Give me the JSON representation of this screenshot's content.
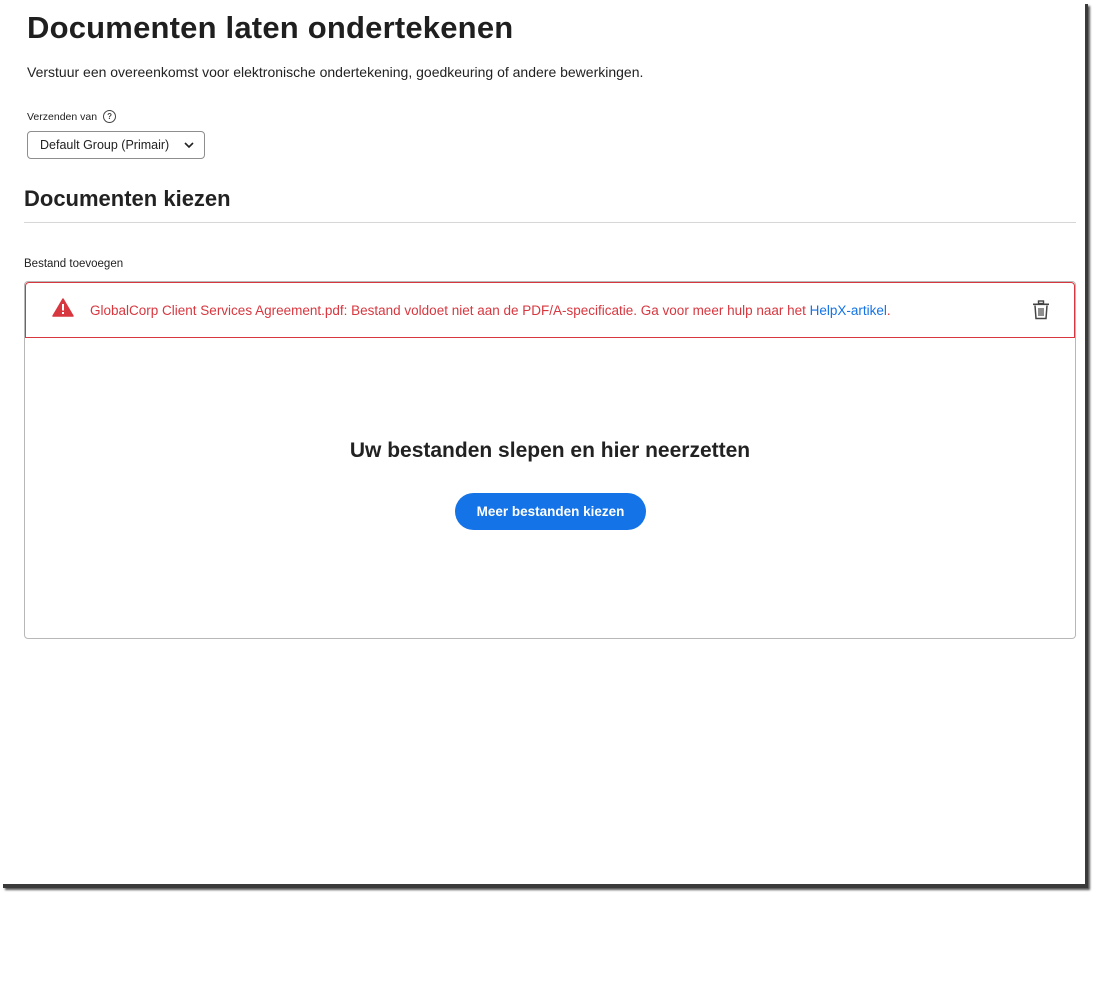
{
  "header": {
    "title": "Documenten laten ondertekenen",
    "subtitle": "Verstuur een overeenkomst voor elektronische ondertekening, goedkeuring of andere bewerkingen."
  },
  "send_from": {
    "label": "Verzenden van",
    "help_glyph": "?",
    "selected": "Default Group (Primair)"
  },
  "documents": {
    "section_title": "Documenten kiezen",
    "add_file_label": "Bestand toevoegen",
    "error": {
      "message": "GlobalCorp Client Services Agreement.pdf: Bestand voldoet niet aan de PDF/A-specificatie. Ga voor meer hulp naar het ",
      "link_text": "HelpX-artikel",
      "suffix": ".",
      "color": "#d7373f"
    },
    "drop_title": "Uw bestanden slepen en hier neerzetten",
    "choose_button": "Meer bestanden kiezen",
    "accent_color": "#1473e6"
  },
  "icons": [
    "help-icon",
    "chevron-down-icon",
    "warning-icon",
    "trash-icon"
  ]
}
